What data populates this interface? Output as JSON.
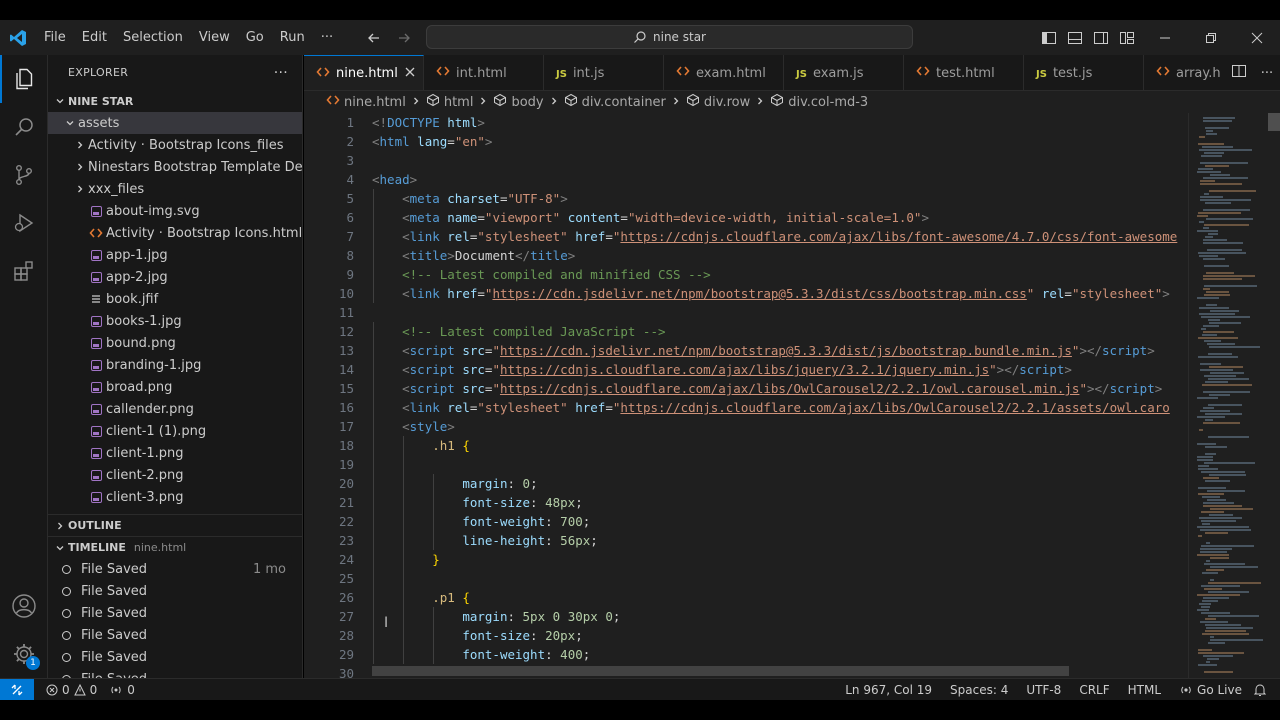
{
  "colors": {
    "accent": "#0078d4",
    "background": "#1f1f1f",
    "sidebar": "#181818"
  },
  "menu": [
    "File",
    "Edit",
    "Selection",
    "View",
    "Go",
    "Run",
    "···"
  ],
  "search": {
    "text": "nine star"
  },
  "explorer": {
    "title": "EXPLORER",
    "more": "···",
    "root": "NINE STAR",
    "folder": "assets",
    "items": [
      {
        "label": "Activity · Bootstrap Icons_files",
        "kind": "folder"
      },
      {
        "label": "Ninestars Bootstrap Template Dem...",
        "kind": "folder"
      },
      {
        "label": "xxx_files",
        "kind": "folder"
      },
      {
        "label": "about-img.svg",
        "kind": "svg"
      },
      {
        "label": "Activity · Bootstrap Icons.html",
        "kind": "html"
      },
      {
        "label": "app-1.jpg",
        "kind": "image"
      },
      {
        "label": "app-2.jpg",
        "kind": "image"
      },
      {
        "label": "book.jfif",
        "kind": "text"
      },
      {
        "label": "books-1.jpg",
        "kind": "image"
      },
      {
        "label": "bound.png",
        "kind": "image"
      },
      {
        "label": "branding-1.jpg",
        "kind": "image"
      },
      {
        "label": "broad.png",
        "kind": "image"
      },
      {
        "label": "callender.png",
        "kind": "image"
      },
      {
        "label": "client-1 (1).png",
        "kind": "image"
      },
      {
        "label": "client-1.png",
        "kind": "image"
      },
      {
        "label": "client-2.png",
        "kind": "image"
      },
      {
        "label": "client-3.png",
        "kind": "image"
      }
    ],
    "outline": "OUTLINE",
    "timeline": {
      "title": "TIMELINE",
      "file": "nine.html",
      "entries": [
        {
          "label": "File Saved",
          "time": "1 mo"
        },
        {
          "label": "File Saved",
          "time": ""
        },
        {
          "label": "File Saved",
          "time": ""
        },
        {
          "label": "File Saved",
          "time": ""
        },
        {
          "label": "File Saved",
          "time": ""
        },
        {
          "label": "File Saved",
          "time": ""
        }
      ]
    }
  },
  "tabs": [
    {
      "label": "nine.html",
      "icon": "html",
      "active": true
    },
    {
      "label": "int.html",
      "icon": "html"
    },
    {
      "label": "int.js",
      "icon": "js"
    },
    {
      "label": "exam.html",
      "icon": "html"
    },
    {
      "label": "exam.js",
      "icon": "js"
    },
    {
      "label": "test.html",
      "icon": "html"
    },
    {
      "label": "test.js",
      "icon": "js"
    },
    {
      "label": "array.h",
      "icon": "html"
    }
  ],
  "breadcrumbs": [
    "nine.html",
    "html",
    "body",
    "div.container",
    "div.row",
    "div.col-md-3"
  ],
  "line_numbers": [
    "1",
    "2",
    "3",
    "4",
    "5",
    "6",
    "7",
    "8",
    "9",
    "10",
    "11",
    "12",
    "13",
    "14",
    "15",
    "16",
    "17",
    "18",
    "19",
    "20",
    "21",
    "22",
    "23",
    "24",
    "25",
    "26",
    "27",
    "28",
    "29",
    "30"
  ],
  "code_lines": [
    [
      [
        "b",
        "<!"
      ],
      [
        "tag",
        "DOCTYPE"
      ],
      [
        "t",
        " "
      ],
      [
        "attr",
        "html"
      ],
      [
        "b",
        ">"
      ]
    ],
    [
      [
        "b",
        "<"
      ],
      [
        "tag",
        "html"
      ],
      [
        "t",
        " "
      ],
      [
        "attr",
        "lang"
      ],
      [
        "t",
        "="
      ],
      [
        "str",
        "\"en\""
      ],
      [
        "b",
        ">"
      ]
    ],
    [],
    [
      [
        "b",
        "<"
      ],
      [
        "tag",
        "head"
      ],
      [
        "b",
        ">"
      ]
    ],
    [
      [
        "i",
        1
      ],
      [
        "b",
        "<"
      ],
      [
        "tag",
        "meta"
      ],
      [
        "t",
        " "
      ],
      [
        "attr",
        "charset"
      ],
      [
        "t",
        "="
      ],
      [
        "str",
        "\"UTF-8\""
      ],
      [
        "b",
        ">"
      ]
    ],
    [
      [
        "i",
        1
      ],
      [
        "b",
        "<"
      ],
      [
        "tag",
        "meta"
      ],
      [
        "t",
        " "
      ],
      [
        "attr",
        "name"
      ],
      [
        "t",
        "="
      ],
      [
        "str",
        "\"viewport\""
      ],
      [
        "t",
        " "
      ],
      [
        "attr",
        "content"
      ],
      [
        "t",
        "="
      ],
      [
        "str",
        "\"width=device-width, initial-scale=1.0\""
      ],
      [
        "b",
        ">"
      ]
    ],
    [
      [
        "i",
        1
      ],
      [
        "b",
        "<"
      ],
      [
        "tag",
        "link"
      ],
      [
        "t",
        " "
      ],
      [
        "attr",
        "rel"
      ],
      [
        "t",
        "="
      ],
      [
        "str",
        "\"stylesheet\""
      ],
      [
        "t",
        " "
      ],
      [
        "attr",
        "href"
      ],
      [
        "t",
        "="
      ],
      [
        "str",
        "\""
      ],
      [
        "url",
        "https://cdnjs.cloudflare.com/ajax/libs/font-awesome/4.7.0/css/font-awesome"
      ]
    ],
    [
      [
        "i",
        1
      ],
      [
        "b",
        "<"
      ],
      [
        "tag",
        "title"
      ],
      [
        "b",
        ">"
      ],
      [
        "t",
        "Document"
      ],
      [
        "b",
        "</"
      ],
      [
        "tag",
        "title"
      ],
      [
        "b",
        ">"
      ]
    ],
    [
      [
        "i",
        1
      ],
      [
        "com",
        "<!-- Latest compiled and minified CSS -->"
      ]
    ],
    [
      [
        "i",
        1
      ],
      [
        "b",
        "<"
      ],
      [
        "tag",
        "link"
      ],
      [
        "t",
        " "
      ],
      [
        "attr",
        "href"
      ],
      [
        "t",
        "="
      ],
      [
        "str",
        "\""
      ],
      [
        "url",
        "https://cdn.jsdelivr.net/npm/bootstrap@5.3.3/dist/css/bootstrap.min.css"
      ],
      [
        "str",
        "\""
      ],
      [
        "t",
        " "
      ],
      [
        "attr",
        "rel"
      ],
      [
        "t",
        "="
      ],
      [
        "str",
        "\"stylesheet\""
      ],
      [
        "b",
        ">"
      ]
    ],
    [],
    [
      [
        "i",
        1
      ],
      [
        "com",
        "<!-- Latest compiled JavaScript -->"
      ]
    ],
    [
      [
        "i",
        1
      ],
      [
        "b",
        "<"
      ],
      [
        "tag",
        "script"
      ],
      [
        "t",
        " "
      ],
      [
        "attr",
        "src"
      ],
      [
        "t",
        "="
      ],
      [
        "str",
        "\""
      ],
      [
        "url",
        "https://cdn.jsdelivr.net/npm/bootstrap@5.3.3/dist/js/bootstrap.bundle.min.js"
      ],
      [
        "str",
        "\""
      ],
      [
        "b",
        "></"
      ],
      [
        "tag",
        "script"
      ],
      [
        "b",
        ">"
      ]
    ],
    [
      [
        "i",
        1
      ],
      [
        "b",
        "<"
      ],
      [
        "tag",
        "script"
      ],
      [
        "t",
        " "
      ],
      [
        "attr",
        "src"
      ],
      [
        "t",
        "="
      ],
      [
        "str",
        "\""
      ],
      [
        "url",
        "https://cdnjs.cloudflare.com/ajax/libs/jquery/3.2.1/jquery.min.js"
      ],
      [
        "str",
        "\""
      ],
      [
        "b",
        "></"
      ],
      [
        "tag",
        "script"
      ],
      [
        "b",
        ">"
      ]
    ],
    [
      [
        "i",
        1
      ],
      [
        "b",
        "<"
      ],
      [
        "tag",
        "script"
      ],
      [
        "t",
        " "
      ],
      [
        "attr",
        "src"
      ],
      [
        "t",
        "="
      ],
      [
        "str",
        "\""
      ],
      [
        "url",
        "https://cdnjs.cloudflare.com/ajax/libs/OwlCarousel2/2.2.1/owl.carousel.min.js"
      ],
      [
        "str",
        "\""
      ],
      [
        "b",
        "></"
      ],
      [
        "tag",
        "script"
      ],
      [
        "b",
        ">"
      ]
    ],
    [
      [
        "i",
        1
      ],
      [
        "b",
        "<"
      ],
      [
        "tag",
        "link"
      ],
      [
        "t",
        " "
      ],
      [
        "attr",
        "rel"
      ],
      [
        "t",
        "="
      ],
      [
        "str",
        "\"stylesheet\""
      ],
      [
        "t",
        " "
      ],
      [
        "attr",
        "href"
      ],
      [
        "t",
        "="
      ],
      [
        "str",
        "\""
      ],
      [
        "url",
        "https://cdnjs.cloudflare.com/ajax/libs/OwlCarousel2/2.2.1/assets/owl.caro"
      ]
    ],
    [
      [
        "i",
        1
      ],
      [
        "b",
        "<"
      ],
      [
        "tag",
        "style"
      ],
      [
        "b",
        ">"
      ]
    ],
    [
      [
        "i",
        2
      ],
      [
        "sel",
        ".h1"
      ],
      [
        "t",
        " "
      ],
      [
        "brace",
        "{"
      ]
    ],
    [
      [
        "i",
        2
      ]
    ],
    [
      [
        "i",
        3
      ],
      [
        "prop",
        "margin"
      ],
      [
        "t",
        ": "
      ],
      [
        "num",
        "0"
      ],
      [
        "t",
        ";"
      ]
    ],
    [
      [
        "i",
        3
      ],
      [
        "prop",
        "font-size"
      ],
      [
        "t",
        ": "
      ],
      [
        "num",
        "48px"
      ],
      [
        "t",
        ";"
      ]
    ],
    [
      [
        "i",
        3
      ],
      [
        "prop",
        "font-weight"
      ],
      [
        "t",
        ": "
      ],
      [
        "num",
        "700"
      ],
      [
        "t",
        ";"
      ]
    ],
    [
      [
        "i",
        3
      ],
      [
        "prop",
        "line-height"
      ],
      [
        "t",
        ": "
      ],
      [
        "num",
        "56px"
      ],
      [
        "t",
        ";"
      ]
    ],
    [
      [
        "i",
        2
      ],
      [
        "brace",
        "}"
      ]
    ],
    [
      [
        "i",
        2
      ]
    ],
    [
      [
        "i",
        2
      ],
      [
        "sel",
        ".p1"
      ],
      [
        "t",
        " "
      ],
      [
        "brace",
        "{"
      ]
    ],
    [
      [
        "i",
        3
      ],
      [
        "prop",
        "margin"
      ],
      [
        "t",
        ": "
      ],
      [
        "num",
        "5px"
      ],
      [
        "t",
        " "
      ],
      [
        "num",
        "0"
      ],
      [
        "t",
        " "
      ],
      [
        "num",
        "30px"
      ],
      [
        "t",
        " "
      ],
      [
        "num",
        "0"
      ],
      [
        "t",
        ";"
      ]
    ],
    [
      [
        "i",
        3
      ],
      [
        "prop",
        "font-size"
      ],
      [
        "t",
        ": "
      ],
      [
        "num",
        "20px"
      ],
      [
        "t",
        ";"
      ]
    ],
    [
      [
        "i",
        3
      ],
      [
        "prop",
        "font-weight"
      ],
      [
        "t",
        ": "
      ],
      [
        "num",
        "400"
      ],
      [
        "t",
        ";"
      ]
    ],
    []
  ],
  "status": {
    "problems_errors": "0",
    "problems_warnings": "0",
    "ports": "0",
    "position": "Ln 967, Col 19",
    "spaces": "Spaces: 4",
    "encoding": "UTF-8",
    "eol": "CRLF",
    "language": "HTML",
    "golive": "Go Live"
  },
  "accounts_badge": "1"
}
